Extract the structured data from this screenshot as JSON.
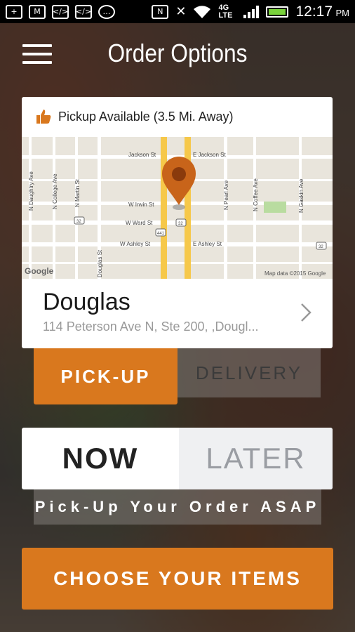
{
  "status_bar": {
    "time": "12:17",
    "ampm": "PM",
    "network": "4G LTE",
    "left_icons": [
      "plus-icon",
      "gmail-icon",
      "code-icon",
      "code-icon",
      "chat-icon"
    ],
    "right_icons": [
      "nfc-icon",
      "mute-icon",
      "wifi-icon",
      "network-icon",
      "signal-icon",
      "battery-icon"
    ]
  },
  "header": {
    "title": "Order Options"
  },
  "location_card": {
    "availability": "Pickup Available (3.5 Mi. Away)",
    "map": {
      "streets": [
        "Jackson St",
        "E Jackson St",
        "W Irwin St",
        "W Ward St",
        "W Ashley St",
        "E Ashley St",
        "N Daughtry Ave",
        "N College Ave",
        "N Martin St",
        "N Pearl Ave",
        "N Coffee Ave",
        "N Gaskin Ave",
        "Douglas St"
      ],
      "route_shields": [
        "441",
        "32",
        "32",
        "32"
      ],
      "attribution_logo": "Google",
      "attribution": "Map data ©2015 Google"
    },
    "store_name": "Douglas",
    "store_address": "114 Peterson Ave N, Ste 200, ,Dougl..."
  },
  "order_type": {
    "pickup_label": "PICK-UP",
    "delivery_label": "DELIVERY",
    "selected": "PICK-UP"
  },
  "timing": {
    "now_label": "NOW",
    "later_label": "LATER",
    "selected": "NOW",
    "message": "Pick-Up Your Order ASAP"
  },
  "cta": {
    "label": "CHOOSE YOUR ITEMS"
  },
  "colors": {
    "accent": "#d9781e",
    "map_road": "#f6c84a",
    "pin": "#c8641a"
  }
}
